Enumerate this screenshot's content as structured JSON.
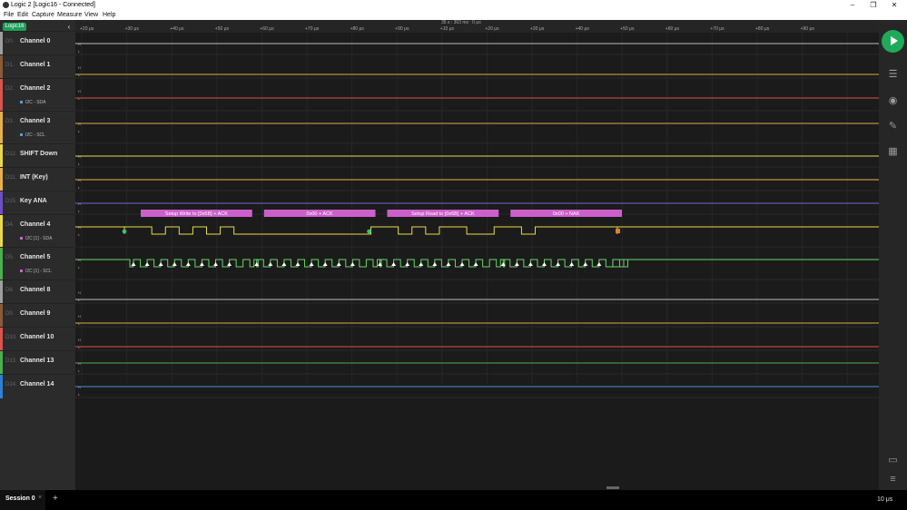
{
  "window": {
    "title": "Logic 2 [Logic16 - Connected]",
    "minimize": "–",
    "maximize": "❐",
    "close": "✕"
  },
  "menu": [
    "File",
    "Edit",
    "Capture",
    "Measure",
    "View",
    "Help"
  ],
  "device": {
    "badge": "Logic16",
    "collapse_icon": "chevron-left-icon"
  },
  "timeline": {
    "cursor_time": "35 s : 363 ms : 0 μs",
    "ticks": [
      "+20 μs",
      "+30 μs",
      "+40 μs",
      "+50 μs",
      "+60 μs",
      "+70 μs",
      "+80 μs",
      "+90 μs",
      "+10 μs",
      "+20 μs",
      "+30 μs",
      "+40 μs",
      "+50 μs",
      "+60 μs",
      "+70 μs",
      "+80 μs",
      "+90 μs"
    ]
  },
  "channels": [
    {
      "index": "D0.",
      "name": "Channel 0",
      "color": "#9e9e9e",
      "wave": "#bdbdbd",
      "high": true
    },
    {
      "index": "D1.",
      "name": "Channel 1",
      "color": "#8a5a3a",
      "wave": "#d4b33a",
      "high": false
    },
    {
      "index": "D2.",
      "name": "Channel 2",
      "color": "#d9534f",
      "wave": "#d9534f",
      "high": false,
      "sub": "I2C - SDA",
      "sub_color": "#5b9bd5"
    },
    {
      "index": "D3.",
      "name": "Channel 3",
      "color": "#e8b04a",
      "wave": "#e0a84a",
      "high": true,
      "sub": "I2C - SCL",
      "sub_color": "#5b9bd5"
    },
    {
      "index": "D12.",
      "name": "SHIFT Down",
      "color": "#e8d94a",
      "wave": "#e8d94a",
      "high": true
    },
    {
      "index": "D11.",
      "name": "INT (Key)",
      "color": "#e8b04a",
      "wave": "#e8b04a",
      "high": true
    },
    {
      "index": "D15.",
      "name": "Key ANA",
      "color": "#6a4fc9",
      "wave": "#7a66d6",
      "high": true
    },
    {
      "index": "D4.",
      "name": "Channel 4",
      "color": "#e8d94a",
      "wave": "#e8d94a",
      "high": true,
      "sub": "I2C [1] - SDA",
      "sub_color": "#cc66cc"
    },
    {
      "index": "D5.",
      "name": "Channel 5",
      "color": "#4caf50",
      "wave": "#6ad46a",
      "high": true,
      "sub": "I2C [1] - SCL",
      "sub_color": "#cc66cc"
    },
    {
      "index": "D6.",
      "name": "Channel 8",
      "color": "#9e9e9e",
      "wave": "#bdbdbd",
      "high": false
    },
    {
      "index": "D9.",
      "name": "Channel 9",
      "color": "#8a5a3a",
      "wave": "#d4b33a",
      "high": false
    },
    {
      "index": "D10.",
      "name": "Channel 10",
      "color": "#d9534f",
      "wave": "#d9534f",
      "high": false
    },
    {
      "index": "D13.",
      "name": "Channel 13",
      "color": "#4caf50",
      "wave": "#4caf50",
      "high": true
    },
    {
      "index": "D14.",
      "name": "Channel 14",
      "color": "#2f7fd6",
      "wave": "#4a90e2",
      "high": true
    }
  ],
  "decodes": [
    {
      "label": "Setup Write to [0x6B] + ACK",
      "start": 0,
      "end": 9
    },
    {
      "label": "0x00 + ACK",
      "start": 9,
      "end": 18
    },
    {
      "label": "Setup Read to [0x6B] + ACK",
      "start": 18,
      "end": 27
    },
    {
      "label": "0x00 + NAK",
      "start": 27,
      "end": 36
    }
  ],
  "sda_bits": [
    1,
    1,
    0,
    1,
    0,
    1,
    0,
    1,
    0,
    0,
    0,
    0,
    0,
    0,
    0,
    0,
    0,
    0,
    1,
    1,
    0,
    1,
    0,
    1,
    1,
    0,
    0,
    1,
    1,
    0,
    1,
    1,
    1,
    1,
    1,
    1
  ],
  "toolbar": [
    "play-icon",
    "analyzers-icon",
    "extensions-icon",
    "measure-icon",
    "layout-icon",
    "comment-icon",
    "menu-icon"
  ],
  "session": {
    "label": "Session 0",
    "close": "×",
    "new": "+",
    "timescale": "10 μs"
  }
}
